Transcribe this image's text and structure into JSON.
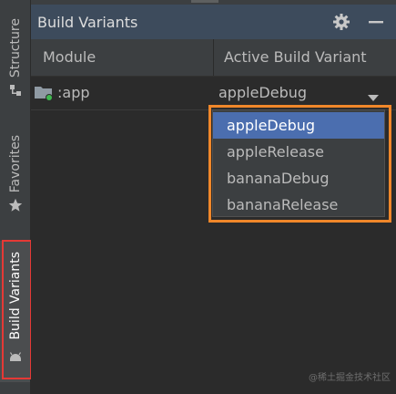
{
  "side_tabs": {
    "structure": "Structure",
    "favorites": "Favorites",
    "build_variants": "Build Variants"
  },
  "panel": {
    "title": "Build Variants",
    "icons": [
      "gear-icon",
      "minimize-icon"
    ]
  },
  "table": {
    "headers": [
      "Module",
      "Active Build Variant"
    ],
    "rows": [
      {
        "module": ":app",
        "variant": "appleDebug",
        "icon": "android-module-folder-icon"
      }
    ]
  },
  "dropdown": {
    "options": [
      "appleDebug",
      "appleRelease",
      "bananaDebug",
      "bananaRelease"
    ],
    "selected": "appleDebug"
  },
  "colors": {
    "title_bar": "#3d4b5c",
    "selection": "#4b6eaf",
    "orange_outline": "#f0872a",
    "red_outline": "#e53935"
  },
  "watermark": "@稀土掘金技术社区"
}
